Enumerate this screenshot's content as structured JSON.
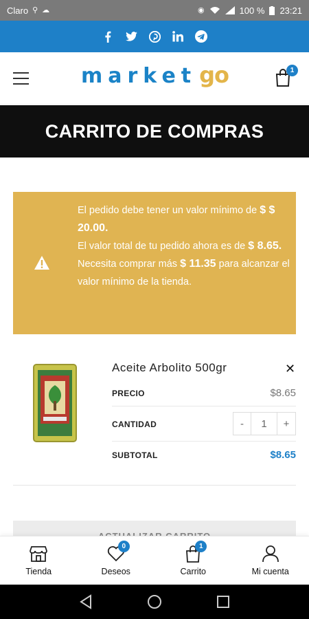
{
  "status_bar": {
    "carrier": "Claro",
    "battery": "100 %",
    "time": "23:21"
  },
  "social": {
    "icons": [
      "facebook-icon",
      "twitter-icon",
      "pinterest-icon",
      "linkedin-icon",
      "telegram-icon"
    ]
  },
  "header": {
    "logo_market": "market",
    "logo_go": "go",
    "cart_count": "1"
  },
  "page_title": "CARRITO DE COMPRAS",
  "notice": {
    "line1": "El pedido debe tener un valor mínimo de ",
    "min_value": "$ $ 20.00.",
    "line2": "El valor total de tu pedido ahora es de ",
    "current_value": "$ 8.65.",
    "line3": "Necesita comprar más ",
    "needed_value": "$ 11.35",
    "line4": " para alcanzar el valor mínimo de la tienda."
  },
  "product": {
    "name": "Aceite Arbolito 500gr",
    "price_label": "PRECIO",
    "price": "$8.65",
    "qty_label": "CANTIDAD",
    "qty_minus": "-",
    "qty_value": "1",
    "qty_plus": "+",
    "subtotal_label": "SUBTOTAL",
    "subtotal": "$8.65",
    "remove": "✕"
  },
  "update_button": "ACTUALIZAR CARRITO",
  "bottom_nav": {
    "tienda": "Tienda",
    "deseos": "Deseos",
    "deseos_count": "0",
    "carrito": "Carrito",
    "carrito_count": "1",
    "cuenta": "Mi cuenta"
  },
  "colors": {
    "brand_blue": "#1e80c8",
    "brand_gold": "#e0b452",
    "title_bg": "#0f0f0f"
  }
}
